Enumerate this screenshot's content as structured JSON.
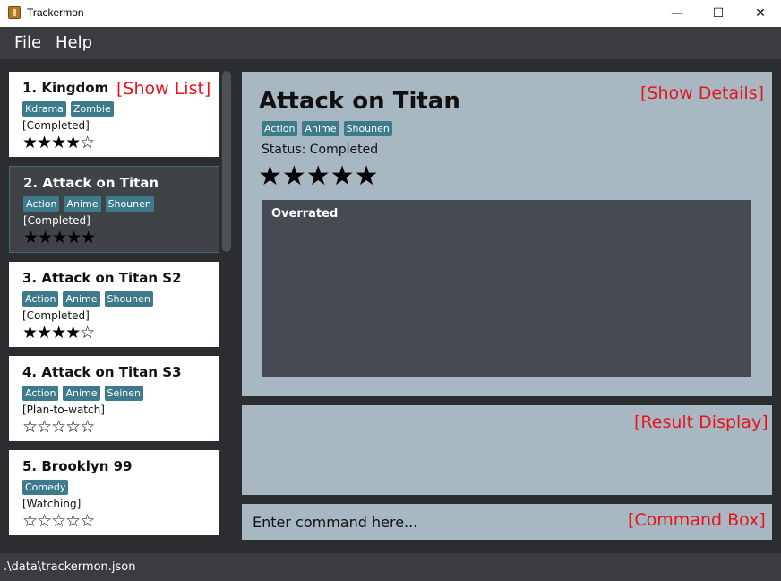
{
  "window": {
    "title": "Trackermon",
    "minimize_glyph": "—",
    "maximize_glyph": "☐",
    "close_glyph": "✕"
  },
  "menu": {
    "file": "File",
    "help": "Help"
  },
  "list": {
    "overlay_label": "[Show List]",
    "items": [
      {
        "title": "1.  Kingdom",
        "tags": [
          "Kdrama",
          "Zombie"
        ],
        "status": "[Completed]",
        "rating": 4,
        "stars": "★★★★☆",
        "selected": false
      },
      {
        "title": "2.  Attack on Titan",
        "tags": [
          "Action",
          "Anime",
          "Shounen"
        ],
        "status": "[Completed]",
        "rating": 5,
        "stars": "★★★★★",
        "selected": true
      },
      {
        "title": "3.  Attack on Titan S2",
        "tags": [
          "Action",
          "Anime",
          "Shounen"
        ],
        "status": "[Completed]",
        "rating": 4,
        "stars": "★★★★☆",
        "selected": false
      },
      {
        "title": "4.  Attack on Titan S3",
        "tags": [
          "Action",
          "Anime",
          "Seinen"
        ],
        "status": "[Plan-to-watch]",
        "rating": 0,
        "stars": "☆☆☆☆☆",
        "selected": false
      },
      {
        "title": "5.  Brooklyn 99",
        "tags": [
          "Comedy"
        ],
        "status": "[Watching]",
        "rating": 0,
        "stars": "☆☆☆☆☆",
        "selected": false
      }
    ]
  },
  "details": {
    "overlay_label": "[Show Details]",
    "title": "Attack on Titan",
    "tags": [
      "Action",
      "Anime",
      "Shounen"
    ],
    "status": "Status: Completed",
    "rating": 5,
    "stars": "★★★★★",
    "notes": "Overrated"
  },
  "result": {
    "overlay_label": "[Result Display]"
  },
  "command": {
    "overlay_label": "[Command Box]",
    "placeholder": "Enter command here..."
  },
  "statusbar": {
    "path": ".\\data\\trackermon.json"
  },
  "colors": {
    "tag": "#3c7a8c",
    "panel": "#a7b8c3",
    "background": "#2b2d31",
    "overlay_red": "#e8141a"
  }
}
